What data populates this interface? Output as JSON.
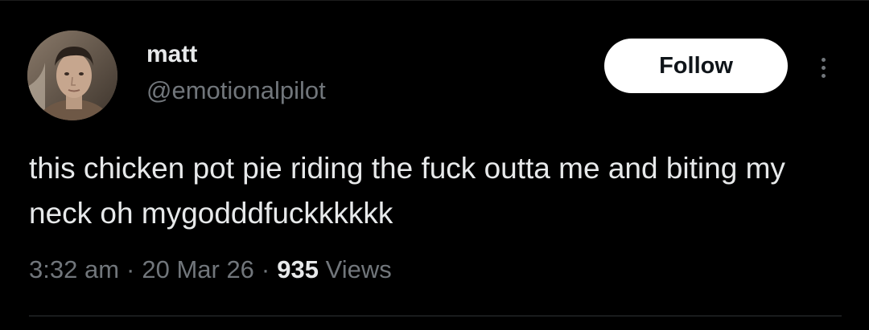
{
  "author": {
    "name": "matt",
    "handle": "@emotionalpilot",
    "avatar_icon": "user-avatar-photo"
  },
  "actions": {
    "follow_label": "Follow",
    "more_icon": "more-vertical-icon"
  },
  "tweet": {
    "text": "this chicken pot pie riding the fuck outta me and biting my neck oh mygodddfuckkkkkk"
  },
  "meta": {
    "time": "3:32 am",
    "separator": "·",
    "date": "20 Mar 26",
    "views_count": "935",
    "views_label": "Views"
  },
  "colors": {
    "background": "#000000",
    "primary_text": "#e7e9ea",
    "secondary_text": "#71767b",
    "follow_bg": "#ffffff",
    "follow_text": "#0f1419",
    "divider": "#2f3336"
  }
}
